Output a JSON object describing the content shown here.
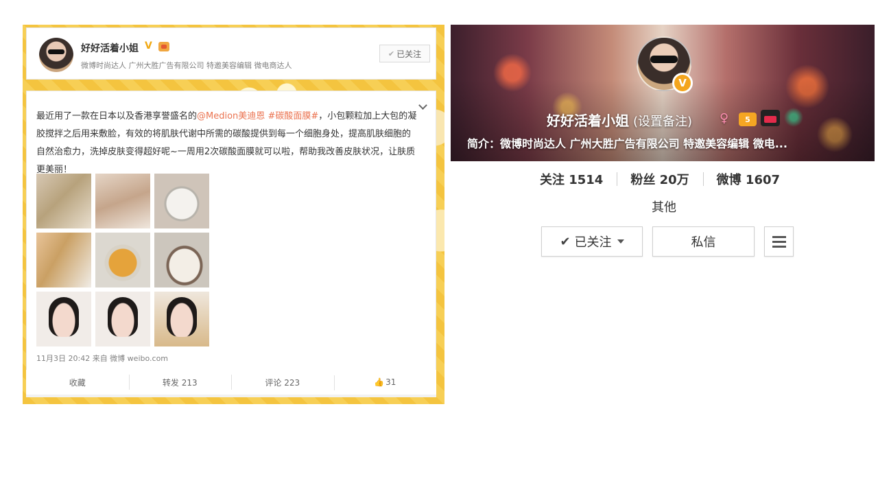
{
  "left": {
    "profile": {
      "name": "好好活着小姐",
      "verified_mark": "V",
      "description": "微博时尚达人 广州大胜广告有限公司 特邀美容编辑 微电商达人",
      "followed_label": "已关注"
    },
    "post": {
      "text_before": "最近用了一款在日本以及香港享誉盛名的",
      "mention": "@Medion美迪恩",
      "topic": "#碳酸面膜#",
      "text_after": "，小包颗粒加上大包的凝胶搅拌之后用来敷脸，有效的将肌肤代谢中所需的碳酸提供到每一个细胞身处，提高肌肤细胞的自然治愈力，洗掉皮肤变得超好呢~一周用2次碳酸面膜就可以啦，帮助我改善皮肤状况，让肤质更美丽！",
      "meta": "11月3日 20:42 来自 微博 weibo.com",
      "photo_count": 9
    },
    "actions": {
      "favorite": "收藏",
      "repost": "转发 213",
      "comment": "评论 223",
      "like_count": "31"
    }
  },
  "right": {
    "banner": {
      "name": "好好活着小姐",
      "remark": "(设置备注)",
      "verified_mark": "V",
      "level_label": "5",
      "intro": "简介：微博时尚达人 广州大胜广告有限公司 特邀美容编辑 微电..."
    },
    "stats": {
      "following": "关注 1514",
      "followers": "粉丝 20万",
      "posts": "微博 1607"
    },
    "other_label": "其他",
    "buttons": {
      "follow": "已关注",
      "message": "私信"
    }
  },
  "colors": {
    "link_orange": "#eb7350",
    "verified_gold": "#f4a51c",
    "background_yellow": "#f4c43f"
  }
}
